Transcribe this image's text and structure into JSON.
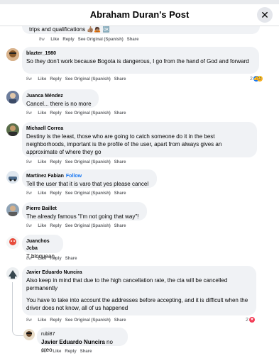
{
  "header": {
    "title": "Abraham Duran's Post",
    "close_label": "✕"
  },
  "actions": {
    "like": "Like",
    "reply": "Reply",
    "see_original": "See Original (Spanish)",
    "share": "Share"
  },
  "comments": [
    {
      "author": "",
      "text": "trips and qualifications 👍🏽🙇🏽 🆗",
      "time": "8w"
    },
    {
      "author": "blazter_1980",
      "text": "So they don't work because Bogota is dangerous, I go from the hand of God and forward",
      "time": "8w",
      "reactions": "2"
    },
    {
      "author": "Juanca Méndez",
      "text": "Cancel... there is no more",
      "time": "8w"
    },
    {
      "author": "Michaell Correa",
      "text": "Destiny is the least, those who are going to catch someone do it in the best neighborhoods, important is the profile of the user, apart from always gives an approximate of where they go",
      "time": "8w"
    },
    {
      "author": "Martínez Fabian",
      "follow": "Follow",
      "text": "Tell the user that it is varo that yes please cancel",
      "time": "8w"
    },
    {
      "author": "Pierre Baillet",
      "text": "The already famous \"I'm not going that way\"!",
      "time": "8w"
    },
    {
      "author": "Juanchos Jcba",
      "text": "T bloquean,",
      "time": "8w"
    },
    {
      "author": "Javier Eduardo Nuncira",
      "text": "Also keep in mind that due to the high cancellation rate, the cta will be cancelled permanently",
      "text2": "You have to take into account the addresses before accepting, and it is difficult when the driver does not know, all of us happened",
      "time": "8w",
      "reactions": "2"
    },
    {
      "author": "rubi87",
      "mention": "Javier Eduardo Nuncira",
      "text": "no creo",
      "time": "8w"
    }
  ],
  "colors": {
    "like_blue": "#1877f2",
    "love_red": "#f33e58",
    "haha_yellow": "#f7b125",
    "follow_blue": "#1877f2"
  }
}
